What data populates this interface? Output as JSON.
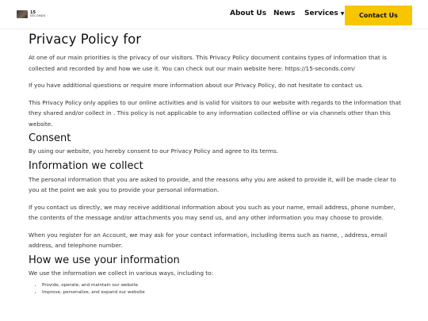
{
  "header": {
    "logo": {
      "number": "15",
      "word": "SECONDS"
    },
    "nav": {
      "about": "About Us",
      "news": "News",
      "services": "Services",
      "contact": "Contact Us"
    }
  },
  "main": {
    "title": "Privacy Policy for",
    "intro_p1": "At one of our main priorities is the privacy of our visitors. This Privacy Policy document contains types of information that is collected and recorded by and how we use it. You can check out our main website here: https://15-seconds.com/",
    "intro_p2": "If you have additional questions or require more information about our Privacy Policy, do not hesitate to contact us.",
    "intro_p3": "This Privacy Policy only applies to our online activities and is valid for visitors to our website with regards to the information that they shared and/or collect in . This policy is not applicable to any information collected offline or via channels other than this website.",
    "consent_heading": "Consent",
    "consent_p1": "By using our website, you hereby consent to our Privacy Policy and agree to its terms.",
    "collect_heading": "Information we collect",
    "collect_p1": "The personal information that you are asked to provide, and the reasons why you are asked to provide it, will be made clear to you at the point we ask you to provide your personal information.",
    "collect_p2": "If you contact us directly, we may receive additional information about you such as your name, email address, phone number, the contents of the message and/or attachments you may send us, and any other information you may choose to provide.",
    "collect_p3": "When you register for an Account, we may ask for your contact information, including items such as name, , address, email address, and telephone number.",
    "use_heading": "How we use your information",
    "use_p1": "We use the information we collect in various ways, including to:",
    "use_items": [
      "Provide, operate, and maintain our website",
      "Improve, personalize, and expand our website"
    ]
  }
}
